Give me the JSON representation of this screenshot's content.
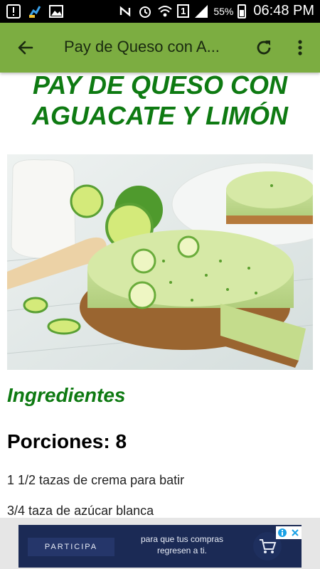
{
  "status_bar": {
    "battery": "55%",
    "time": "06:48 PM",
    "sim": "1"
  },
  "app_bar": {
    "title": "Pay de Queso con A...",
    "back_icon": "arrow-back-icon",
    "refresh_icon": "refresh-icon",
    "more_icon": "more-vert-icon"
  },
  "recipe": {
    "title_line1": "PAY DE QUESO CON",
    "title_line2": "AGUACATE Y LIMÓN",
    "photo_icon": "cheesecake-photo",
    "section_heading": "Ingredientes",
    "servings": "Porciones: 8",
    "ingredients": [
      "1 1/2 tazas de crema para batir",
      "3/4 taza de azúcar blanca"
    ]
  },
  "ad": {
    "cta": "PARTICIPA",
    "text_line1": "para que tus compras",
    "text_line2": "regresen a ti.",
    "cart_icon": "shopping-cart-icon",
    "adchoices_icon": "adchoices-icon"
  },
  "colors": {
    "app_bar": "#7cad41",
    "title_green": "#0e7a12",
    "ad_background": "#1b2a55"
  }
}
